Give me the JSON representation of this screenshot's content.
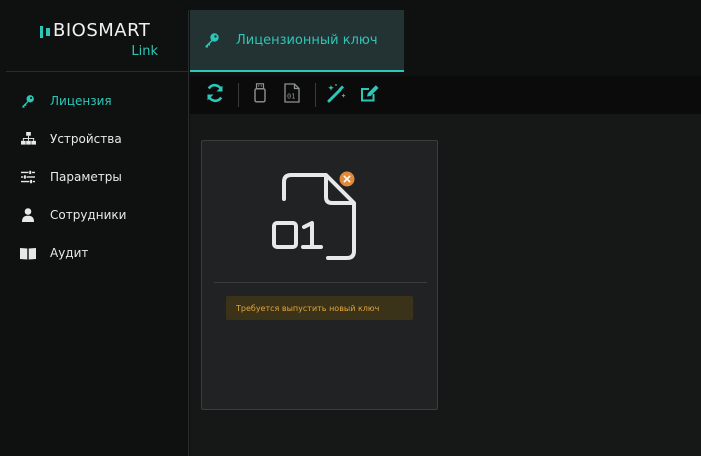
{
  "brand": {
    "name": "BIOSMART",
    "sub": "Link",
    "accent": "#2cc7b8"
  },
  "sidebar": {
    "items": [
      {
        "label": "Лицензия",
        "icon": "key-icon",
        "active": true
      },
      {
        "label": "Устройства",
        "icon": "sitemap-icon",
        "active": false
      },
      {
        "label": "Параметры",
        "icon": "sliders-icon",
        "active": false
      },
      {
        "label": "Сотрудники",
        "icon": "user-icon",
        "active": false
      },
      {
        "label": "Аудит",
        "icon": "book-icon",
        "active": false
      }
    ]
  },
  "header": {
    "tab": {
      "label": "Лицензионный ключ",
      "icon": "key-icon"
    }
  },
  "toolbar": {
    "buttons": [
      {
        "icon": "refresh-icon"
      },
      {
        "icon": "usb-drive-icon"
      },
      {
        "icon": "binary-file-icon"
      },
      {
        "icon": "magic-wand-icon"
      },
      {
        "icon": "edit-icon"
      }
    ]
  },
  "license_card": {
    "icon": "binary-file-error-icon",
    "file_text": "01",
    "warning": "Требуется выпустить новый ключ",
    "warning_color": "#e4a53a"
  }
}
